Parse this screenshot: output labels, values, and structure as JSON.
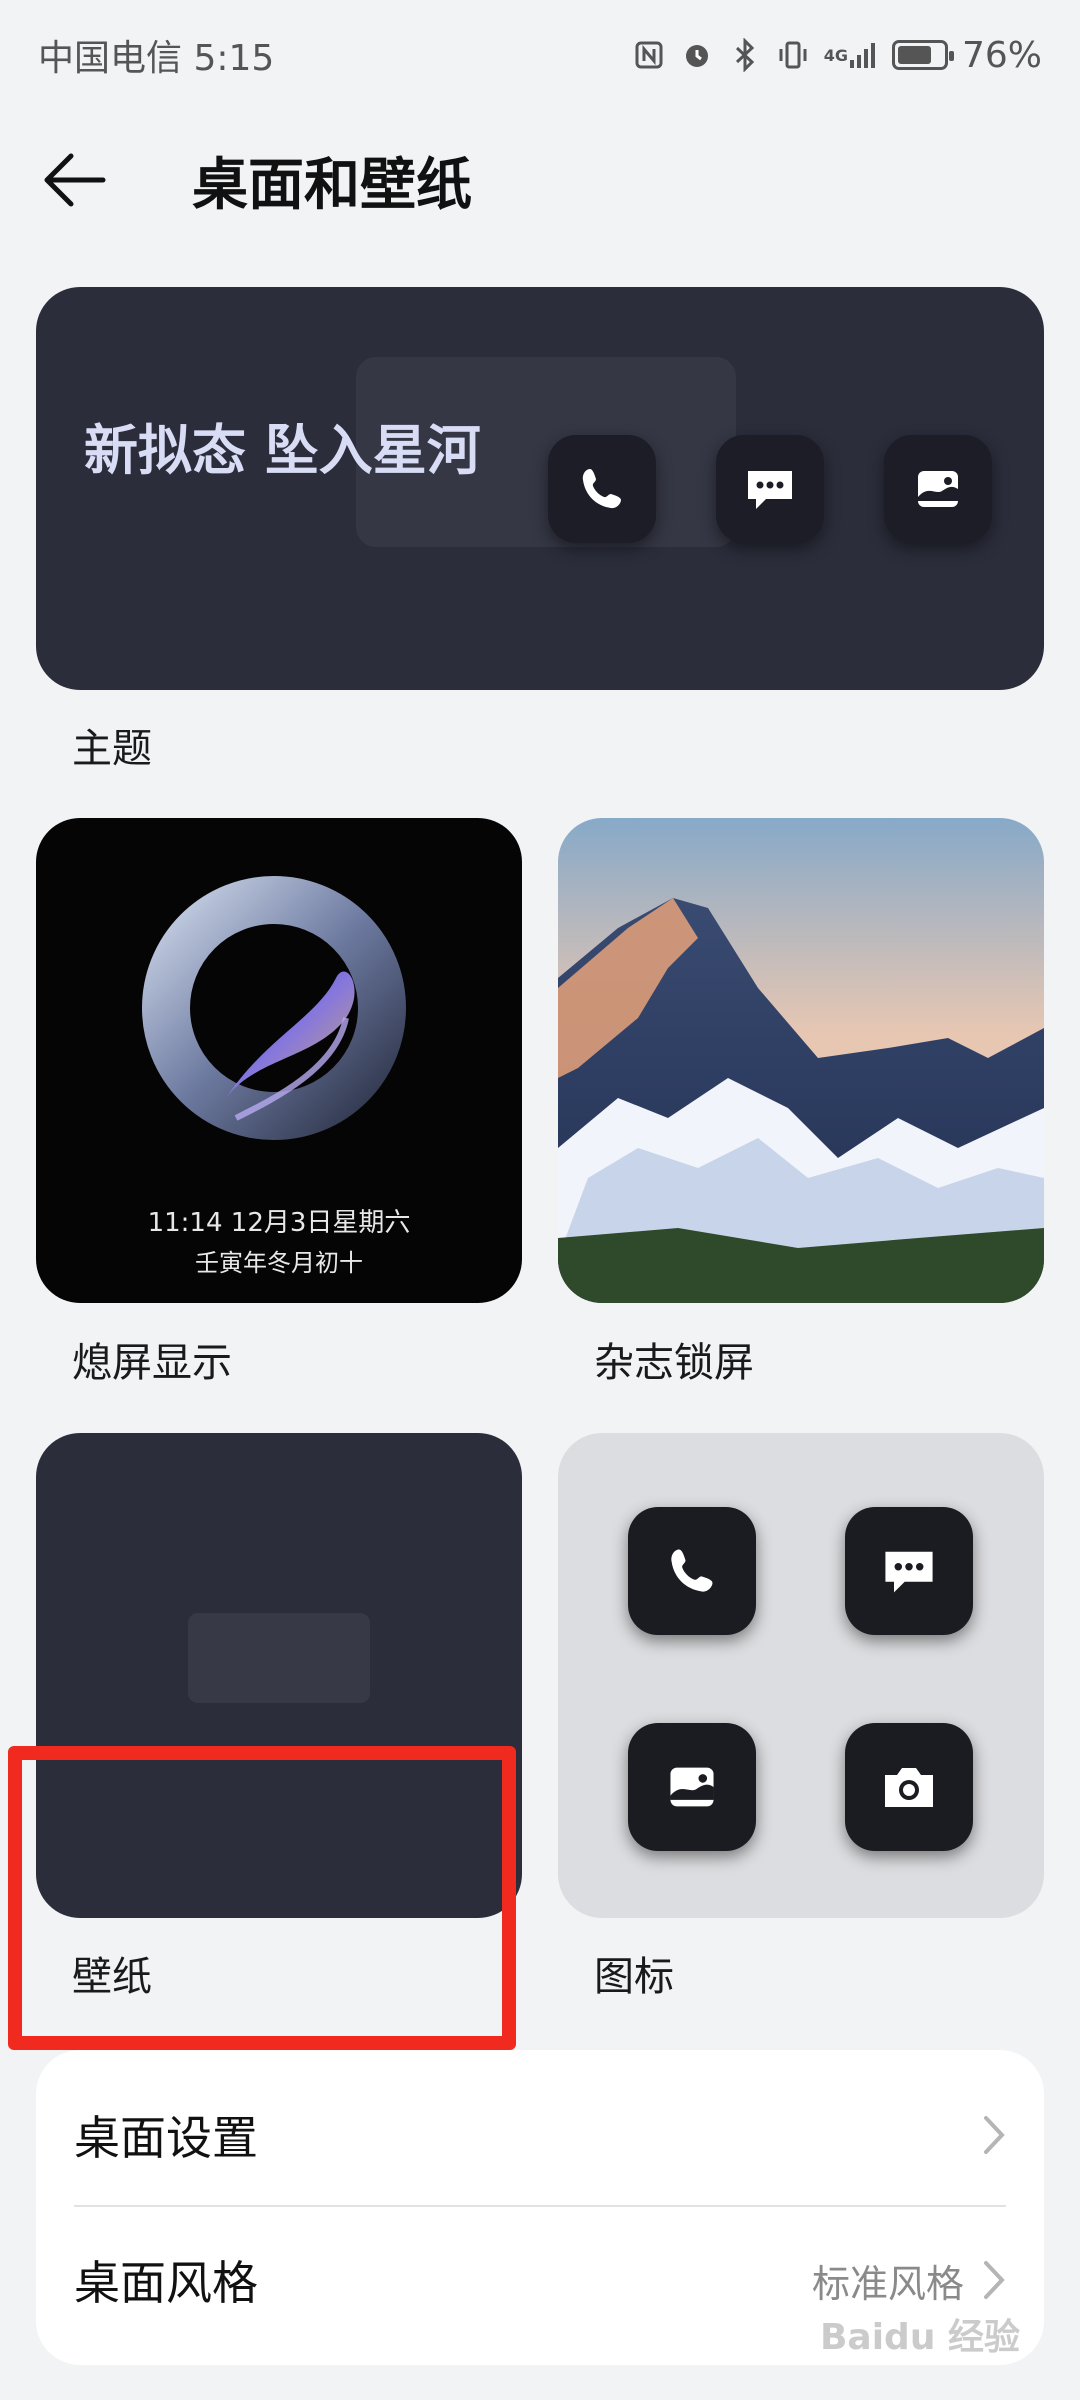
{
  "status_bar": {
    "carrier_time": "中国电信 5:15",
    "signal_label": "4G",
    "battery": "76%",
    "battery_level": 0.76
  },
  "header": {
    "title": "桌面和壁纸"
  },
  "theme": {
    "name": "新拟态 坠入星河",
    "label": "主题"
  },
  "aod": {
    "time_date": "11:14  12月3日星期六",
    "lunar": "壬寅年冬月初十",
    "label": "熄屏显示"
  },
  "magazine": {
    "label": "杂志锁屏"
  },
  "wallpaper": {
    "label": "壁纸"
  },
  "icons": {
    "label": "图标",
    "tiles": [
      "phone-icon",
      "message-icon",
      "gallery-icon",
      "camera-icon"
    ]
  },
  "settings": {
    "rows": [
      {
        "label": "桌面设置",
        "value": ""
      },
      {
        "label": "桌面风格",
        "value": "标准风格"
      }
    ]
  },
  "watermark": "Baidu 经验",
  "colors": {
    "highlight": "#f02a1e",
    "card_dark": "#2b2d3b",
    "background": "#f1f3f5"
  }
}
